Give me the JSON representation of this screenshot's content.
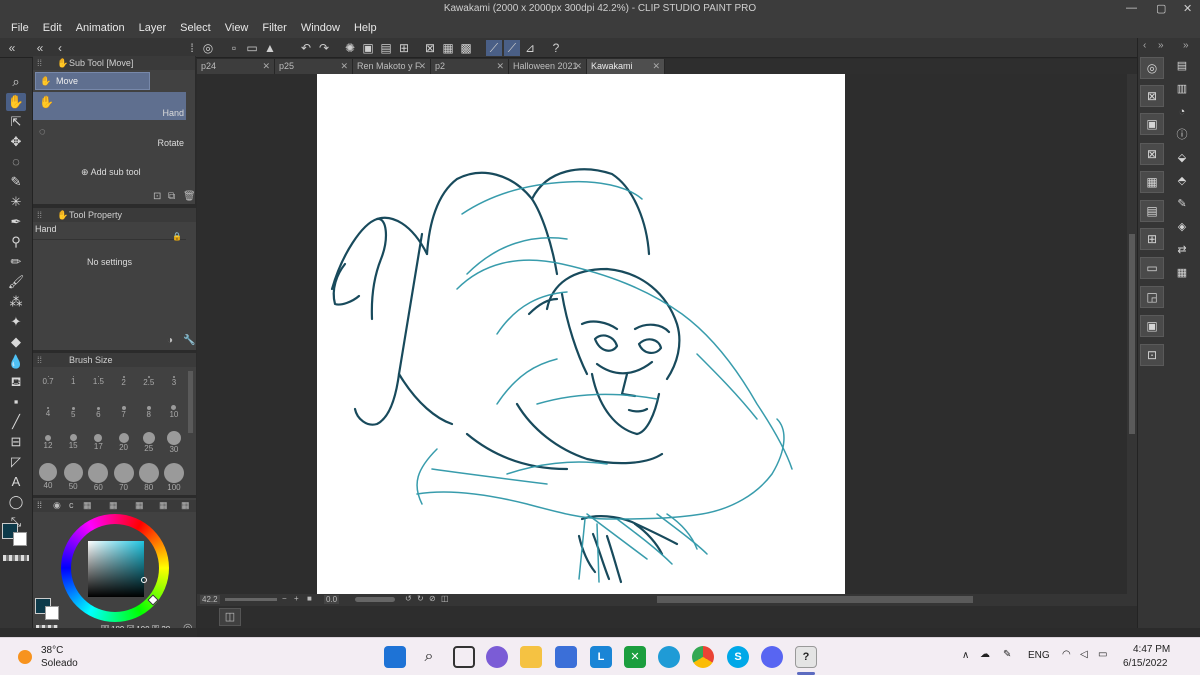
{
  "window": {
    "title": "Kawakami (2000 x 2000px 300dpi 42.2%) - CLIP STUDIO PAINT PRO"
  },
  "menu": [
    "File",
    "Edit",
    "Animation",
    "Layer",
    "Select",
    "View",
    "Filter",
    "Window",
    "Help"
  ],
  "subtool_panel": {
    "title": "Sub Tool [Move]",
    "category": "Move",
    "items": [
      {
        "label": "Hand",
        "selected": true
      },
      {
        "label": "Rotate",
        "selected": false
      }
    ],
    "add_label": "Add sub tool"
  },
  "tool_property": {
    "title": "Tool Property",
    "tool_name": "Hand",
    "empty_text": "No settings"
  },
  "brush_size": {
    "title": "Brush Size",
    "rows": [
      [
        "0.7",
        "1",
        "1.5",
        "2",
        "2.5",
        "3"
      ],
      [
        "4",
        "5",
        "6",
        "7",
        "8",
        "10"
      ],
      [
        "12",
        "15",
        "17",
        "20",
        "25",
        "30"
      ],
      [
        "40",
        "50",
        "60",
        "70",
        "80",
        "100"
      ]
    ]
  },
  "color": {
    "main": "#0d3a4a",
    "sub": "#ffffff",
    "h_label": "H",
    "h": "189",
    "s_label": "S",
    "s": "100",
    "v_label": "V",
    "v": "28"
  },
  "tabs": [
    {
      "label": "p24",
      "active": false
    },
    {
      "label": "p25",
      "active": false
    },
    {
      "label": "Ren Makoto y F",
      "active": false
    },
    {
      "label": "p2",
      "active": false
    },
    {
      "label": "Halloween 2021",
      "active": false
    },
    {
      "label": "Kawakami",
      "active": true
    }
  ],
  "navigator": {
    "zoom": "42.2",
    "angle": "0.0"
  },
  "taskbar": {
    "weather_temp": "38°C",
    "weather_desc": "Soleado",
    "language": "ENG",
    "time": "4:47 PM",
    "date": "6/15/2022"
  },
  "sketch_colors": {
    "dark": "#184a5c",
    "light": "#2e97a8"
  }
}
